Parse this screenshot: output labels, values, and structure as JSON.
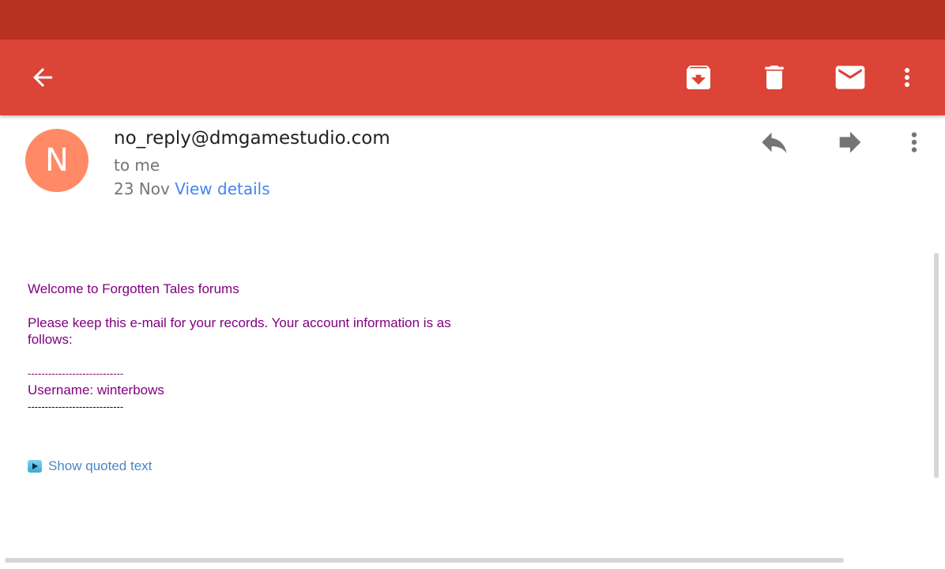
{
  "toolbar": {
    "back_icon": "arrow-back-icon",
    "archive_icon": "archive-icon",
    "delete_icon": "trash-icon",
    "mail_icon": "mail-icon",
    "overflow_icon": "more-vert-icon",
    "color": "#db4437",
    "status_color": "#b93221"
  },
  "message": {
    "avatar_letter": "N",
    "avatar_color": "#ff8a65",
    "sender": "no_reply@dmgamestudio.com",
    "recipient": "to me",
    "date": "23 Nov",
    "view_details": "View details",
    "reply_icon": "reply-icon",
    "forward_icon": "forward-icon",
    "overflow_icon": "more-vert-icon"
  },
  "body": {
    "greeting": "Welcome to Forgotten Tales forums",
    "line1": "Please keep this e-mail for your records. Your account information is as",
    "line2": "follows:",
    "separator_top": "----------------------------",
    "username_line": "Username: winterbows",
    "separator_bottom": "----------------------------",
    "show_quoted": "Show quoted text"
  }
}
